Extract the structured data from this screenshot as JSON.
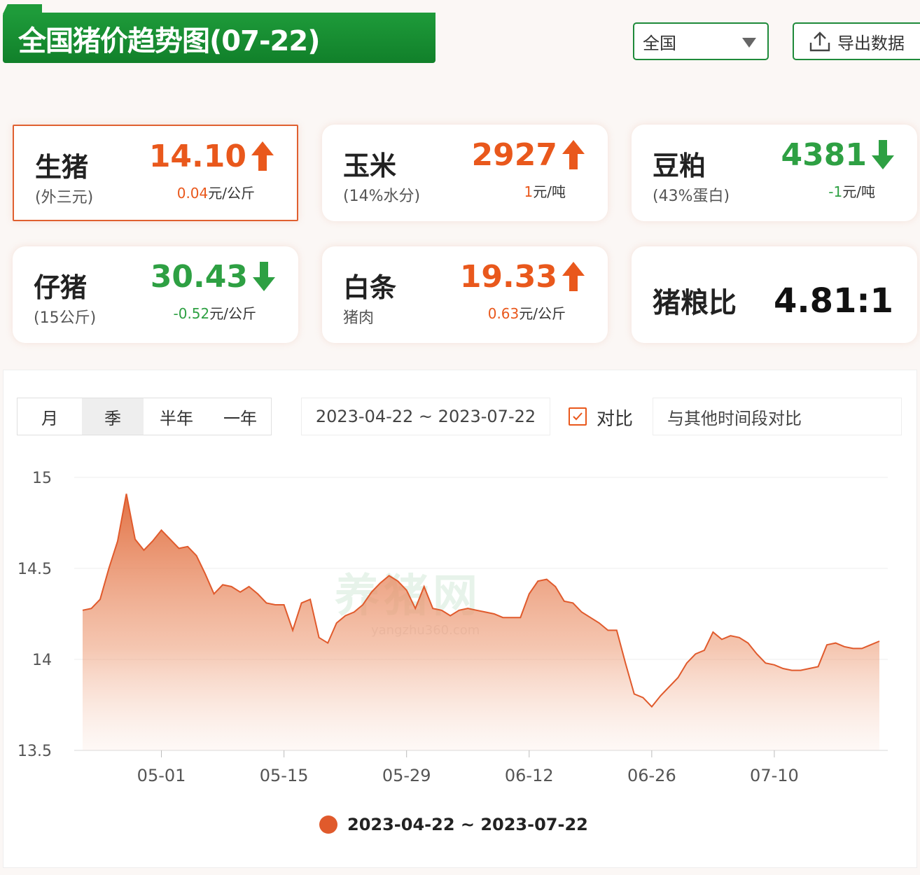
{
  "header": {
    "title": "全国猪价趋势图(07-22)",
    "region": "全国",
    "export_label": "导出数据"
  },
  "cards": [
    {
      "name": "生猪",
      "sub": "(外三元)",
      "value": "14.10",
      "direction": "up",
      "change": "0.04",
      "unit": "元/公斤"
    },
    {
      "name": "玉米",
      "sub": "(14%水分)",
      "value": "2927",
      "direction": "up",
      "change": "1",
      "unit": "元/吨"
    },
    {
      "name": "豆粕",
      "sub": "(43%蛋白)",
      "value": "4381",
      "direction": "down",
      "change": "-1",
      "unit": "元/吨"
    },
    {
      "name": "仔猪",
      "sub": "(15公斤)",
      "value": "30.43",
      "direction": "down",
      "change": "-0.52",
      "unit": "元/公斤"
    },
    {
      "name": "白条",
      "sub": "猪肉",
      "value": "19.33",
      "direction": "up",
      "change": "0.63",
      "unit": "元/公斤"
    }
  ],
  "ratio": {
    "name": "猪粮比",
    "value": "4.81:1"
  },
  "tabs": [
    "月",
    "季",
    "半年",
    "一年"
  ],
  "active_tab": "季",
  "date_range": "2023-04-22 ~ 2023-07-22",
  "compare": {
    "label": "对比",
    "placeholder": "与其他时间段对比"
  },
  "watermark": {
    "main": "养猪网",
    "sub": "yangzhu360.com"
  },
  "colors": {
    "up": "#e9581c",
    "down": "#2ea043",
    "series": "#e05a2c",
    "brand_green": "#1e8a3a"
  },
  "chart_data": {
    "type": "area",
    "x_ticks": [
      "05-01",
      "05-15",
      "05-29",
      "06-12",
      "06-26",
      "07-10"
    ],
    "y_ticks": [
      13.5,
      14,
      14.5,
      15
    ],
    "ylim": [
      13.5,
      15
    ],
    "legend": "2023-04-22 ~ 2023-07-22",
    "series": [
      {
        "name": "2023-04-22 ~ 2023-07-22",
        "x": [
          "04-22",
          "04-23",
          "04-24",
          "04-25",
          "04-26",
          "04-27",
          "04-28",
          "04-29",
          "04-30",
          "05-01",
          "05-02",
          "05-03",
          "05-04",
          "05-05",
          "05-06",
          "05-07",
          "05-08",
          "05-09",
          "05-10",
          "05-11",
          "05-12",
          "05-13",
          "05-14",
          "05-15",
          "05-16",
          "05-17",
          "05-18",
          "05-19",
          "05-20",
          "05-21",
          "05-22",
          "05-23",
          "05-24",
          "05-25",
          "05-26",
          "05-27",
          "05-28",
          "05-29",
          "05-30",
          "05-31",
          "06-01",
          "06-02",
          "06-03",
          "06-04",
          "06-05",
          "06-06",
          "06-07",
          "06-08",
          "06-09",
          "06-10",
          "06-11",
          "06-12",
          "06-13",
          "06-14",
          "06-15",
          "06-16",
          "06-17",
          "06-18",
          "06-19",
          "06-20",
          "06-21",
          "06-22",
          "06-23",
          "06-24",
          "06-25",
          "06-26",
          "06-27",
          "06-28",
          "06-29",
          "06-30",
          "07-01",
          "07-02",
          "07-03",
          "07-04",
          "07-05",
          "07-06",
          "07-07",
          "07-08",
          "07-09",
          "07-10",
          "07-11",
          "07-12",
          "07-13",
          "07-14",
          "07-15",
          "07-16",
          "07-17",
          "07-18",
          "07-19",
          "07-20",
          "07-21",
          "07-22"
        ],
        "values": [
          14.27,
          14.28,
          14.33,
          14.5,
          14.65,
          14.91,
          14.66,
          14.6,
          14.65,
          14.71,
          14.66,
          14.61,
          14.62,
          14.57,
          14.47,
          14.36,
          14.41,
          14.4,
          14.37,
          14.4,
          14.36,
          14.31,
          14.3,
          14.3,
          14.16,
          14.31,
          14.33,
          14.12,
          14.09,
          14.2,
          14.24,
          14.26,
          14.3,
          14.37,
          14.42,
          14.46,
          14.43,
          14.38,
          14.28,
          14.4,
          14.28,
          14.27,
          14.24,
          14.27,
          14.28,
          14.27,
          14.26,
          14.25,
          14.23,
          14.23,
          14.23,
          14.36,
          14.43,
          14.44,
          14.4,
          14.32,
          14.31,
          14.26,
          14.23,
          14.2,
          14.16,
          14.16,
          13.98,
          13.81,
          13.79,
          13.74,
          13.8,
          13.85,
          13.9,
          13.98,
          14.03,
          14.05,
          14.15,
          14.11,
          14.13,
          14.12,
          14.09,
          14.03,
          13.98,
          13.97,
          13.95,
          13.94,
          13.94,
          13.95,
          13.96,
          14.08,
          14.09,
          14.07,
          14.06,
          14.06,
          14.08,
          14.1
        ]
      }
    ]
  }
}
